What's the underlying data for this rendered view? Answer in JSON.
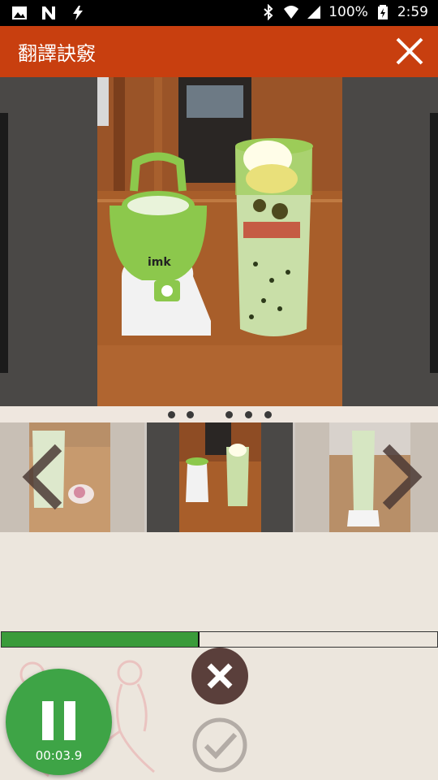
{
  "status_bar": {
    "battery": "100%",
    "time": "2:59"
  },
  "app_bar": {
    "title": "翻譯訣竅"
  },
  "carousel": {
    "page_count": 6,
    "active_index": 2
  },
  "recording": {
    "progress": 0.45,
    "elapsed": "00:03.9"
  },
  "icons": [
    "image-icon",
    "n-app-icon",
    "flash-icon",
    "bluetooth-icon",
    "wifi-icon",
    "signal-icon",
    "battery-charging-icon",
    "close-icon",
    "chevron-left-icon",
    "chevron-right-icon",
    "cancel-icon",
    "check-icon",
    "pause-icon"
  ],
  "colors": {
    "app_bar": "#c83f0f",
    "progress": "#3a9b3a",
    "pause_button": "#3ea446",
    "cancel_button": "#5a3f3b"
  }
}
